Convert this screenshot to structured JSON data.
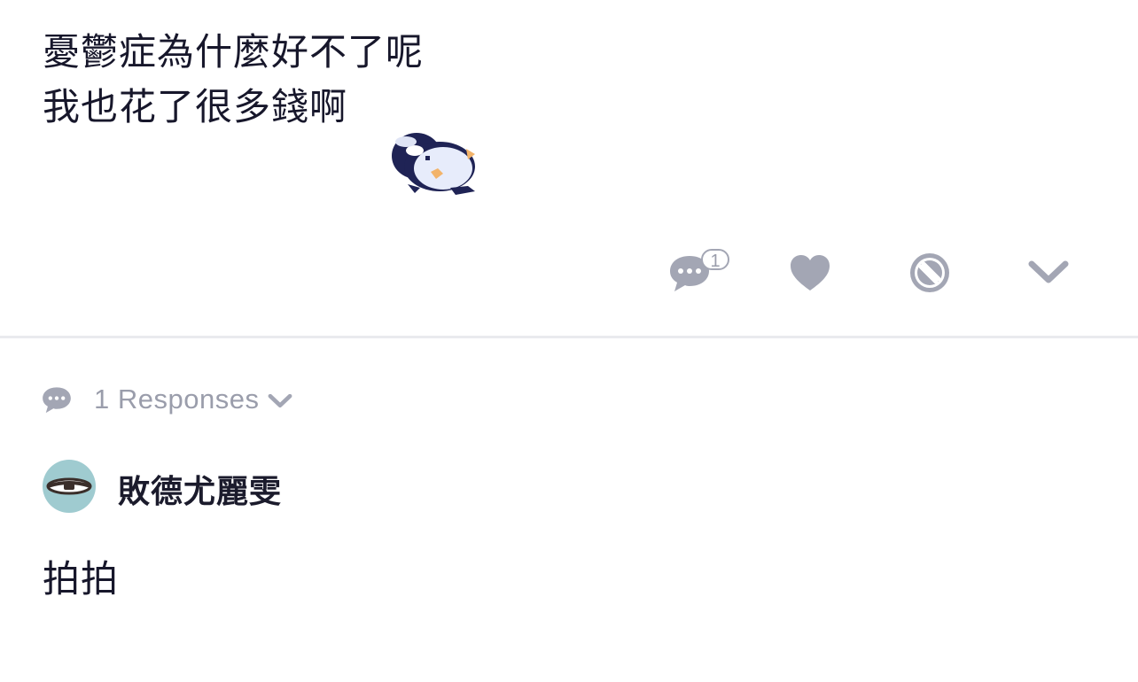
{
  "post": {
    "lines": [
      "憂鬱症為什麼好不了呢",
      "我也花了很多錢啊"
    ]
  },
  "actions": {
    "comment_count": "1",
    "icons": [
      "comment-icon",
      "heart-icon",
      "share-link-icon",
      "chevron-down-icon"
    ]
  },
  "responses": {
    "label": "1 Responses"
  },
  "comment": {
    "author": "敗德尤麗雯",
    "text": "拍拍"
  },
  "colors": {
    "icon_gray": "#a3a6b4",
    "text_dark": "#17172b",
    "avatar_bg": "#9fcbd0",
    "divider": "#e9eaee"
  }
}
